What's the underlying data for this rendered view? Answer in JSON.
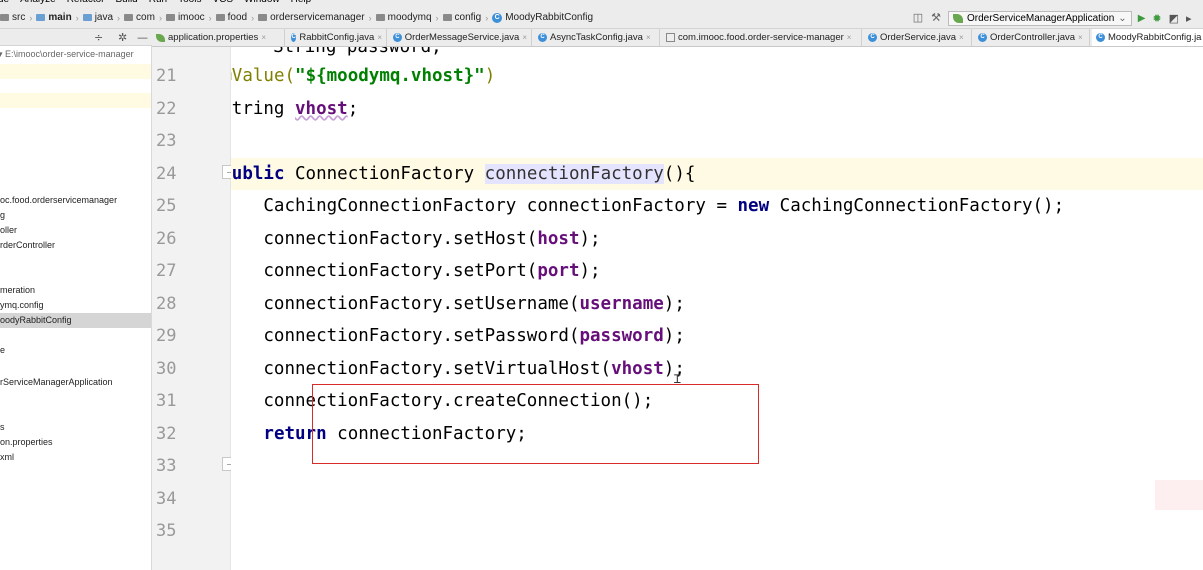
{
  "menu": [
    "de",
    "Analyze",
    "Refactor",
    "Build",
    "Run",
    "Tools",
    "VCS",
    "Window",
    "Help"
  ],
  "breadcrumbs": [
    {
      "label": "src",
      "icon": "folder-icon"
    },
    {
      "label": "main",
      "icon": "source-folder-icon",
      "bold": true
    },
    {
      "label": "java",
      "icon": "source-folder-icon"
    },
    {
      "label": "com",
      "icon": "folder-icon"
    },
    {
      "label": "imooc",
      "icon": "folder-icon"
    },
    {
      "label": "food",
      "icon": "folder-icon"
    },
    {
      "label": "orderservicemanager",
      "icon": "folder-icon"
    },
    {
      "label": "moodymq",
      "icon": "folder-icon"
    },
    {
      "label": "config",
      "icon": "folder-icon"
    },
    {
      "label": "MoodyRabbitConfig",
      "icon": "class-icon"
    }
  ],
  "run_config": {
    "label": "OrderServiceManagerApplication"
  },
  "project": {
    "root_path": "E:\\imooc\\order-service-manager",
    "items": [
      {
        "label": "oc.food.orderservicemanager",
        "state": ""
      },
      {
        "label": "g",
        "state": ""
      },
      {
        "label": "oller",
        "state": ""
      },
      {
        "label": "rderController",
        "state": ""
      },
      {
        "label": "meration",
        "state": ""
      },
      {
        "label": "ymq.config",
        "state": ""
      },
      {
        "label": "oodyRabbitConfig",
        "state": "selected"
      },
      {
        "label": "e",
        "state": ""
      },
      {
        "label": "rServiceManagerApplication",
        "state": ""
      },
      {
        "label": "s",
        "state": ""
      },
      {
        "label": "on.properties",
        "state": ""
      },
      {
        "label": "xml",
        "state": ""
      }
    ]
  },
  "tabs": [
    {
      "label": "application.properties",
      "icon": "leaf-icon",
      "active": false
    },
    {
      "label": "RabbitConfig.java",
      "icon": "class-icon",
      "active": false
    },
    {
      "label": "OrderMessageService.java",
      "icon": "class-icon",
      "active": false
    },
    {
      "label": "AsyncTaskConfig.java",
      "icon": "class-icon",
      "active": false
    },
    {
      "label": "com.imooc.food.order-service-manager",
      "icon": "module-icon",
      "active": false
    },
    {
      "label": "OrderService.java",
      "icon": "class-icon",
      "active": false
    },
    {
      "label": "OrderController.java",
      "icon": "class-icon",
      "active": false
    },
    {
      "label": "MoodyRabbitConfig.ja",
      "icon": "class-icon",
      "active": true
    }
  ],
  "tab_close_glyph": "×",
  "gutter": {
    "line_numbers": [
      "21",
      "22",
      "23",
      "24",
      "25",
      "26",
      "27",
      "28",
      "29",
      "30",
      "31",
      "32",
      "33",
      "34",
      "35"
    ]
  },
  "code": {
    "top_partial": "    String password;",
    "lines": [
      {
        "n": 21,
        "tokens": [
          [
            "",
            "        "
          ],
          [
            "anno",
            "@Value("
          ],
          [
            "str",
            "\"${moodymq.vhost}\""
          ],
          [
            "anno",
            ")"
          ]
        ]
      },
      {
        "n": 22,
        "tokens": [
          [
            "",
            "        String "
          ],
          [
            "fld squig",
            "vhost"
          ],
          [
            "",
            ";"
          ]
        ]
      },
      {
        "n": 23,
        "tokens": []
      },
      {
        "n": 24,
        "tokens": [
          [
            "",
            "        "
          ],
          [
            "kw",
            "public"
          ],
          [
            "",
            " ConnectionFactory "
          ],
          [
            "hlref",
            "connectionFactory"
          ],
          [
            "",
            "(){"
          ]
        ],
        "current": true
      },
      {
        "n": 25,
        "tokens": [
          [
            "",
            "            CachingConnectionFactory connectionFactory = "
          ],
          [
            "kw",
            "new"
          ],
          [
            "",
            " CachingConnectionFactory();"
          ]
        ]
      },
      {
        "n": 26,
        "tokens": [
          [
            "",
            "            connectionFactory.setHost("
          ],
          [
            "fld",
            "host"
          ],
          [
            "",
            ");"
          ]
        ]
      },
      {
        "n": 27,
        "tokens": [
          [
            "",
            "            connectionFactory.setPort("
          ],
          [
            "fld",
            "port"
          ],
          [
            "",
            ");"
          ]
        ]
      },
      {
        "n": 28,
        "tokens": [
          [
            "",
            "            connectionFactory.setUsername("
          ],
          [
            "fld",
            "username"
          ],
          [
            "",
            ");"
          ]
        ]
      },
      {
        "n": 29,
        "tokens": [
          [
            "",
            "            connectionFactory.setPassword("
          ],
          [
            "fld",
            "password"
          ],
          [
            "",
            ");"
          ]
        ]
      },
      {
        "n": 30,
        "tokens": [
          [
            "",
            "            connectionFactory.setVirtualHost("
          ],
          [
            "fld",
            "vhost"
          ],
          [
            "",
            ");"
          ]
        ]
      },
      {
        "n": 31,
        "tokens": [
          [
            "",
            "            connectionFactory.createConnection();"
          ]
        ]
      },
      {
        "n": 32,
        "tokens": [
          [
            "",
            "            "
          ],
          [
            "kw",
            "return"
          ],
          [
            "",
            " connectionFactory;"
          ]
        ]
      },
      {
        "n": 33,
        "tokens": [
          [
            "",
            "        }"
          ]
        ]
      },
      {
        "n": 34,
        "tokens": [
          [
            "",
            "    }"
          ]
        ]
      },
      {
        "n": 35,
        "tokens": []
      }
    ]
  },
  "colors": {
    "keyword": "#000080",
    "annotation": "#808000",
    "string": "#008000",
    "field": "#660e7a",
    "current_line": "#fffae3",
    "highlight_box": "#d92a2a"
  }
}
